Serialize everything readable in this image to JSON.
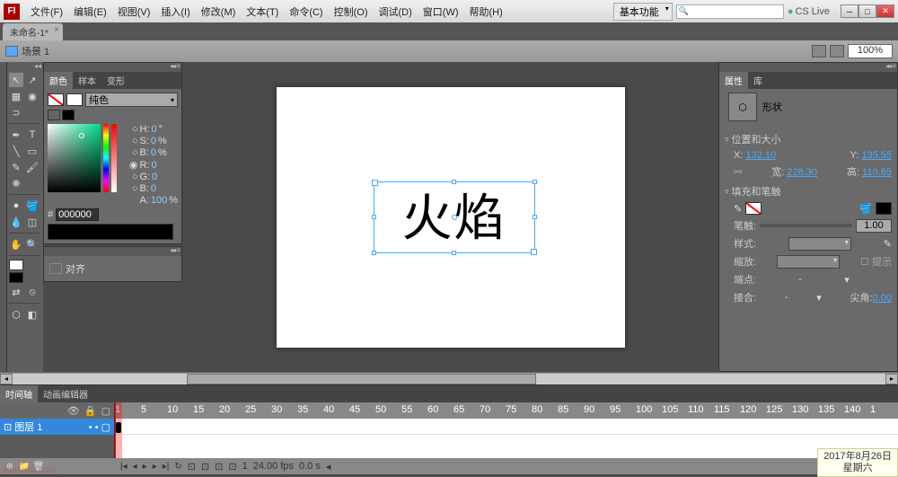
{
  "menubar": {
    "app": "Fl",
    "items": [
      "文件(F)",
      "编辑(E)",
      "视图(V)",
      "插入(I)",
      "修改(M)",
      "文本(T)",
      "命令(C)",
      "控制(O)",
      "调试(D)",
      "窗口(W)",
      "帮助(H)"
    ],
    "workspace": "基本功能",
    "cslive": "CS Live"
  },
  "doctab": "未命名-1*",
  "editbar": {
    "scene": "场景 1",
    "zoom": "100%"
  },
  "colorPanel": {
    "tabs": [
      "颜色",
      "样本",
      "变形"
    ],
    "fillType": "纯色",
    "h": {
      "lbl": "H:",
      "val": "0",
      "unit": "°"
    },
    "s": {
      "lbl": "S:",
      "val": "0",
      "unit": "%"
    },
    "b": {
      "lbl": "B:",
      "val": "0",
      "unit": "%"
    },
    "r": {
      "lbl": "R:",
      "val": "0"
    },
    "g": {
      "lbl": "G:",
      "val": "0"
    },
    "bb": {
      "lbl": "B:",
      "val": "0"
    },
    "a": {
      "lbl": "A:",
      "val": "100",
      "unit": "%"
    },
    "hexPrefix": "#",
    "hex": "000000"
  },
  "alignPanel": {
    "tab": "对齐"
  },
  "canvasText": "火焰",
  "propPanel": {
    "tabs": [
      "属性",
      "库"
    ],
    "objectType": "形状",
    "posGroup": "位置和大小",
    "x": {
      "lbl": "X:",
      "val": "132.10"
    },
    "y": {
      "lbl": "Y:",
      "val": "135.55"
    },
    "w": {
      "lbl": "宽:",
      "val": "228.30"
    },
    "h": {
      "lbl": "高:",
      "val": "110.65"
    },
    "fillGroup": "填充和笔触",
    "strokeLbl": "笔触:",
    "strokeVal": "1.00",
    "styleLbl": "样式:",
    "scaleLbl": "缩放:",
    "hintLbl": "提示",
    "capLbl": "端点:",
    "capVal": "-",
    "joinLbl": "接合:",
    "joinVal": "-",
    "miterLbl": "尖角:",
    "miterVal": "0.00"
  },
  "timeline": {
    "tabs": [
      "时间轴",
      "动画编辑器"
    ],
    "layer": "图层 1",
    "ruler": [
      "1",
      "5",
      "10",
      "15",
      "20",
      "25",
      "30",
      "35",
      "40",
      "45",
      "50",
      "55",
      "60",
      "65",
      "70",
      "75",
      "80",
      "85",
      "90",
      "95",
      "100",
      "105",
      "110",
      "115",
      "120",
      "125",
      "130",
      "135",
      "140",
      "1"
    ],
    "frameNum": "1",
    "fps": "24.00 fps",
    "time": "0.0 s"
  },
  "datestamp": {
    "date": "2017年8月26日",
    "day": "星期六"
  },
  "watermark": "dabaoku.com"
}
